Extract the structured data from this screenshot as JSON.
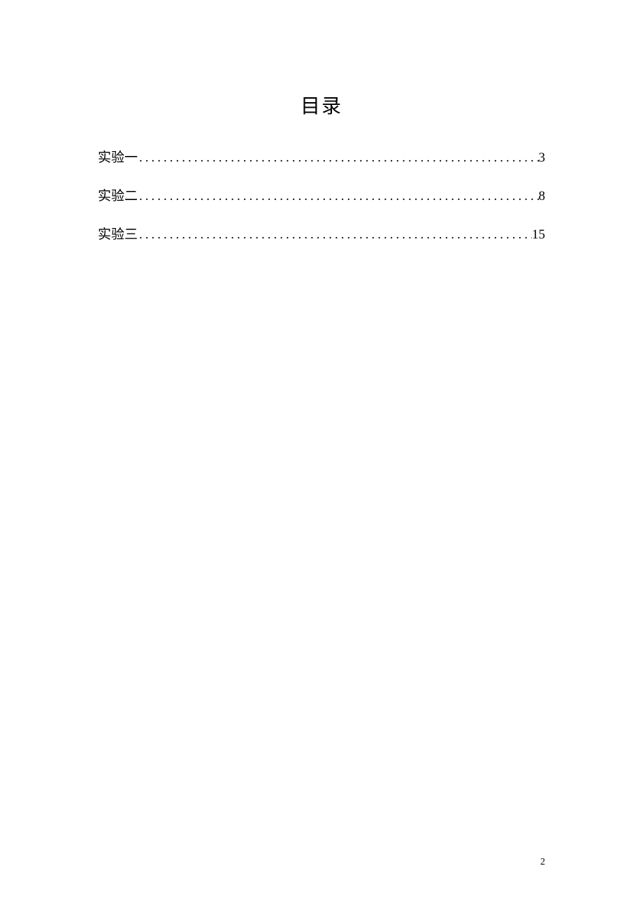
{
  "title": "目录",
  "toc": [
    {
      "label": "实验一",
      "page": "3"
    },
    {
      "label": "实验二",
      "page": "8"
    },
    {
      "label": "实验三",
      "page": "15"
    }
  ],
  "page_number": "2"
}
